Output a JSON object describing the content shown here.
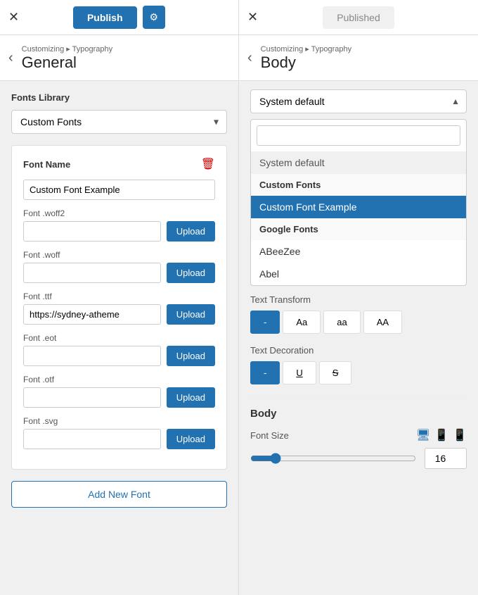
{
  "header": {
    "publish_label": "Publish",
    "settings_icon": "⚙",
    "close_icon": "✕",
    "published_label": "Published"
  },
  "left_panel": {
    "breadcrumb_nav": "Customizing ▸ Typography",
    "breadcrumb_title": "General",
    "back_icon": "‹",
    "fonts_library_label": "Fonts Library",
    "font_select_value": "Custom Fonts",
    "font_select_arrow": "▾",
    "font_card": {
      "title": "Font Name",
      "delete_icon": "🗑",
      "name_value": "Custom Font Example",
      "fields": [
        {
          "label": "Font .woff2",
          "value": "",
          "upload": "Upload"
        },
        {
          "label": "Font .woff",
          "value": "",
          "upload": "Upload"
        },
        {
          "label": "Font .ttf",
          "value": "https://sydney-atheme",
          "upload": "Upload"
        },
        {
          "label": "Font .eot",
          "value": "",
          "upload": "Upload"
        },
        {
          "label": "Font .otf",
          "value": "",
          "upload": "Upload"
        },
        {
          "label": "Font .svg",
          "value": "",
          "upload": "Upload"
        }
      ]
    },
    "add_font_label": "Add New Font"
  },
  "right_panel": {
    "breadcrumb_nav": "Customizing ▸ Typography",
    "breadcrumb_title": "Body",
    "back_icon": "‹",
    "font_selector_value": "System default",
    "font_selector_arrow": "▲",
    "dropdown": {
      "search_placeholder": "",
      "items": [
        {
          "type": "system",
          "label": "System default"
        },
        {
          "type": "group",
          "label": "Custom Fonts"
        },
        {
          "type": "item-selected",
          "label": "Custom Font Example"
        },
        {
          "type": "group",
          "label": "Google Fonts"
        },
        {
          "type": "item",
          "label": "ABeeZee"
        },
        {
          "type": "item",
          "label": "Abel"
        }
      ]
    },
    "text_transform_label": "Text Transform",
    "transform_options": [
      {
        "label": "-",
        "active": true
      },
      {
        "label": "Aa",
        "active": false
      },
      {
        "label": "aa",
        "active": false
      },
      {
        "label": "AA",
        "active": false
      }
    ],
    "text_decoration_label": "Text Decoration",
    "decoration_options": [
      {
        "label": "-",
        "active": true
      },
      {
        "label": "U̲",
        "active": false
      },
      {
        "label": "S̶",
        "active": false
      }
    ],
    "body_section": {
      "title": "Body",
      "font_size_label": "Font Size",
      "font_size_value": "16",
      "slider_value": "16"
    }
  }
}
